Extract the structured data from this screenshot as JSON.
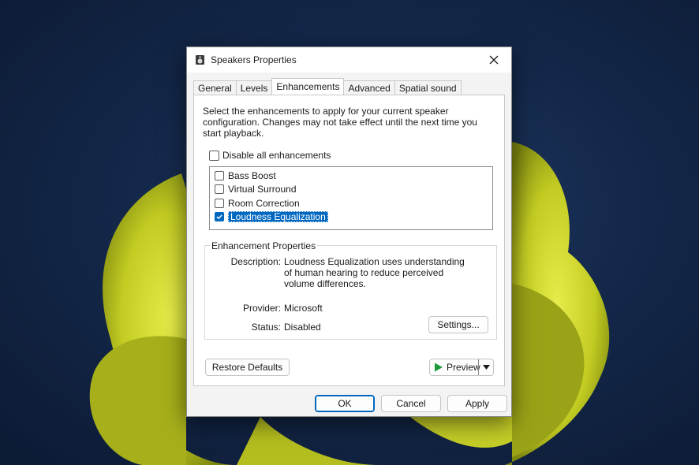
{
  "window": {
    "title": "Speakers Properties"
  },
  "tabs": [
    {
      "label": "General",
      "active": false
    },
    {
      "label": "Levels",
      "active": false
    },
    {
      "label": "Enhancements",
      "active": true
    },
    {
      "label": "Advanced",
      "active": false
    },
    {
      "label": "Spatial sound",
      "active": false
    }
  ],
  "enhancements": {
    "intro": "Select the enhancements to apply for your current speaker configuration. Changes may not take effect until the next time you start playback.",
    "disable_all": {
      "label": "Disable all enhancements",
      "checked": false
    },
    "items": [
      {
        "label": "Bass Boost",
        "checked": false,
        "selected": false
      },
      {
        "label": "Virtual Surround",
        "checked": false,
        "selected": false
      },
      {
        "label": "Room Correction",
        "checked": false,
        "selected": false
      },
      {
        "label": "Loudness Equalization",
        "checked": true,
        "selected": true
      }
    ]
  },
  "properties": {
    "legend": "Enhancement Properties",
    "description_label": "Description:",
    "description": "Loudness Equalization uses understanding of human hearing to reduce perceived volume differences.",
    "provider_label": "Provider:",
    "provider": "Microsoft",
    "status_label": "Status:",
    "status": "Disabled",
    "settings_button": "Settings..."
  },
  "buttons": {
    "restore_defaults": "Restore Defaults",
    "preview": "Preview",
    "ok": "OK",
    "cancel": "Cancel",
    "apply": "Apply"
  },
  "colors": {
    "accent": "#0067c0",
    "preview_play": "#1a9a3a",
    "bloom": "#c9d22a"
  }
}
